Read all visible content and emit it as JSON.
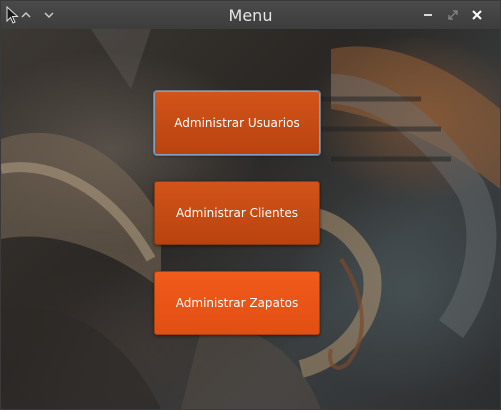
{
  "window": {
    "title": "Menu",
    "icons": [
      "cursor-icon",
      "chevron-up-icon",
      "chevron-down-icon",
      "minimize-icon",
      "maximize-icon",
      "close-icon"
    ]
  },
  "menu": {
    "buttons": [
      {
        "label": "Administrar Usuarios"
      },
      {
        "label": "Administrar Clientes"
      },
      {
        "label": "Administrar Zapatos"
      }
    ]
  },
  "colors": {
    "button": "#c84b14",
    "button_active": "#ee5519",
    "titlebar": "#434343",
    "title_text": "#e6e6e6"
  }
}
